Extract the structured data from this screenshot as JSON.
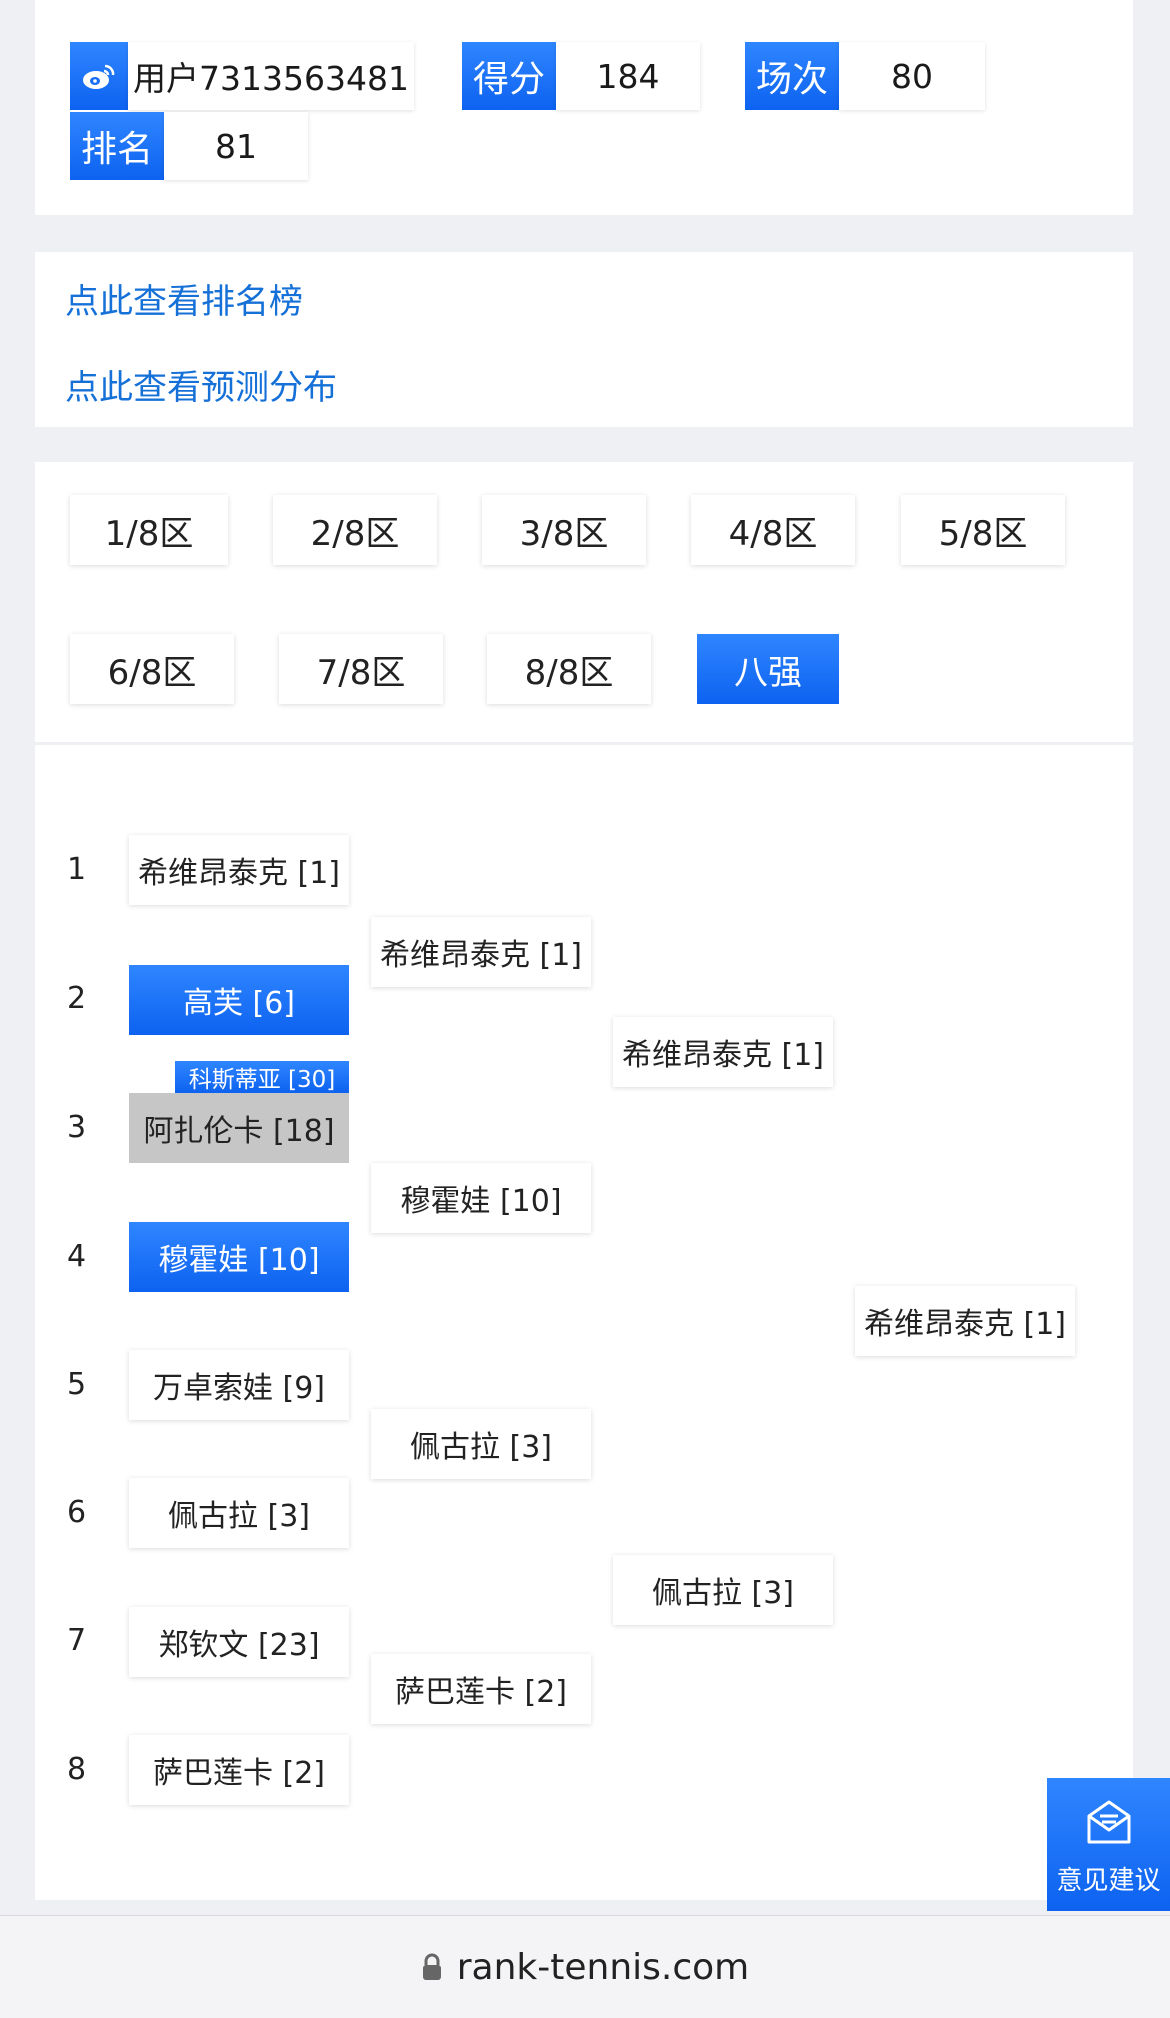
{
  "user": {
    "name": "用户7313563481",
    "score_label": "得分",
    "score_value": "184",
    "matches_label": "场次",
    "matches_value": "80",
    "rank_label": "排名",
    "rank_value": "81"
  },
  "links": {
    "ranking": "点此查看排名榜",
    "distribution": "点此查看预测分布"
  },
  "tabs": [
    "1/8区",
    "2/8区",
    "3/8区",
    "4/8区",
    "5/8区",
    "6/8区",
    "7/8区",
    "8/8区",
    "八强"
  ],
  "active_tab": "八强",
  "bracket": {
    "round1": [
      {
        "seed": "1",
        "name": "希维昂泰克 [1]",
        "state": "normal"
      },
      {
        "seed": "2",
        "name": "高芙 [6]",
        "state": "selected"
      },
      {
        "seed": "3",
        "name": "阿扎伦卡 [18]",
        "state": "eliminated",
        "overlay": "科斯蒂亚 [30]"
      },
      {
        "seed": "4",
        "name": "穆霍娃 [10]",
        "state": "selected"
      },
      {
        "seed": "5",
        "name": "万卓索娃 [9]",
        "state": "normal"
      },
      {
        "seed": "6",
        "name": "佩古拉 [3]",
        "state": "normal"
      },
      {
        "seed": "7",
        "name": "郑钦文 [23]",
        "state": "normal"
      },
      {
        "seed": "8",
        "name": "萨巴莲卡 [2]",
        "state": "normal"
      }
    ],
    "round2": [
      "希维昂泰克 [1]",
      "穆霍娃 [10]",
      "佩古拉 [3]",
      "萨巴莲卡 [2]"
    ],
    "round3": [
      "希维昂泰克 [1]",
      "佩古拉 [3]"
    ],
    "final": "希维昂泰克 [1]"
  },
  "feedback_label": "意见建议",
  "footer_url": "rank-tennis.com",
  "colors": {
    "accent": "#1a6ef5",
    "link": "#1570d8",
    "eliminated": "#c6c6c6"
  }
}
